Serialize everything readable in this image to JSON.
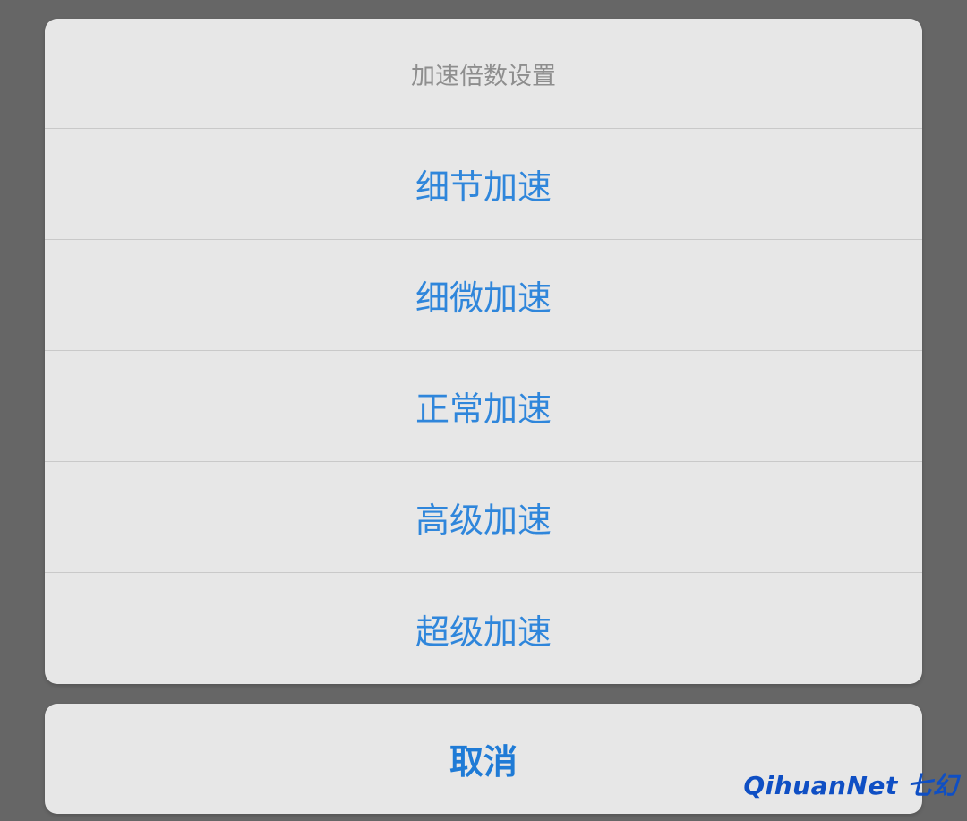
{
  "dialog": {
    "title": "加速倍数设置",
    "options": [
      {
        "label": "细节加速"
      },
      {
        "label": "细微加速"
      },
      {
        "label": "正常加速"
      },
      {
        "label": "高级加速"
      },
      {
        "label": "超级加速"
      }
    ],
    "cancel_label": "取消"
  },
  "watermark": {
    "text": "QihuanNet 七幻"
  },
  "colors": {
    "overlay": "#666666",
    "sheet_bg": "#e7e7e7",
    "option_text": "#2f86db",
    "title_text": "#8e8e8e",
    "divider": "#c9c9c9",
    "watermark": "#0f4fc4"
  }
}
